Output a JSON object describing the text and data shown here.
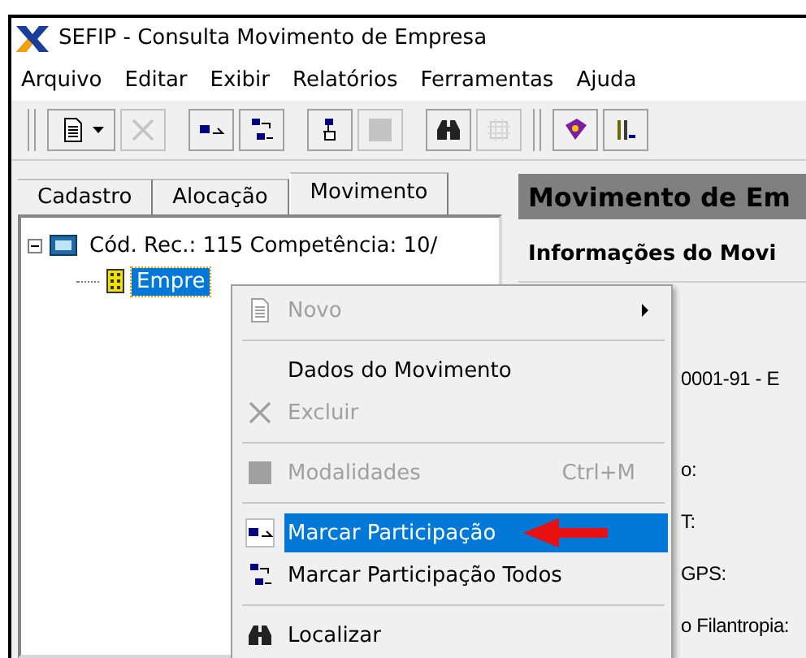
{
  "window": {
    "title": "SEFIP - Consulta Movimento de Empresa"
  },
  "menu_bar": [
    "Arquivo",
    "Editar",
    "Exibir",
    "Relatórios",
    "Ferramentas",
    "Ajuda"
  ],
  "toolbar": [
    {
      "disabled": false
    },
    {
      "disabled": true
    },
    {
      "disabled": false
    },
    {
      "disabled": false
    },
    {
      "disabled": false
    },
    {
      "disabled": true
    },
    {
      "disabled": false
    },
    {
      "disabled": true
    },
    {
      "disabled": false
    },
    {
      "disabled": false
    }
  ],
  "tabs": [
    {
      "label": "Cadastro",
      "selected": false
    },
    {
      "label": "Alocação",
      "selected": false
    },
    {
      "label": "Movimento",
      "selected": true
    }
  ],
  "tree": [
    {
      "label": "Cód. Rec.: 115 Competência: 10/",
      "expanded": true,
      "selected": false,
      "children": [
        {
          "label": "Empre",
          "selected": true
        }
      ]
    }
  ],
  "panel": {
    "title": "Movimento de Em",
    "group_title": "Informações do Movi",
    "fields": [
      "0001-91 - E",
      "o:",
      "T:",
      "GPS:",
      "o Filantropia:"
    ]
  },
  "context_menu": [
    {
      "kind": "item",
      "label": "Novo",
      "disabled": true,
      "selected": false,
      "submenu": true
    },
    {
      "kind": "separator"
    },
    {
      "kind": "item",
      "label": "Dados do Movimento",
      "disabled": false,
      "selected": false
    },
    {
      "kind": "item",
      "label": "Excluir",
      "disabled": true,
      "selected": false
    },
    {
      "kind": "separator"
    },
    {
      "kind": "item",
      "label": "Modalidades",
      "disabled": true,
      "selected": false,
      "shortcut": "Ctrl+M"
    },
    {
      "kind": "separator"
    },
    {
      "kind": "item",
      "label": "Marcar Participação",
      "disabled": false,
      "selected": true
    },
    {
      "kind": "item",
      "label": "Marcar Participação Todos",
      "disabled": false,
      "selected": false
    },
    {
      "kind": "separator"
    },
    {
      "kind": "item",
      "label": "Localizar",
      "disabled": false,
      "selected": false
    }
  ]
}
